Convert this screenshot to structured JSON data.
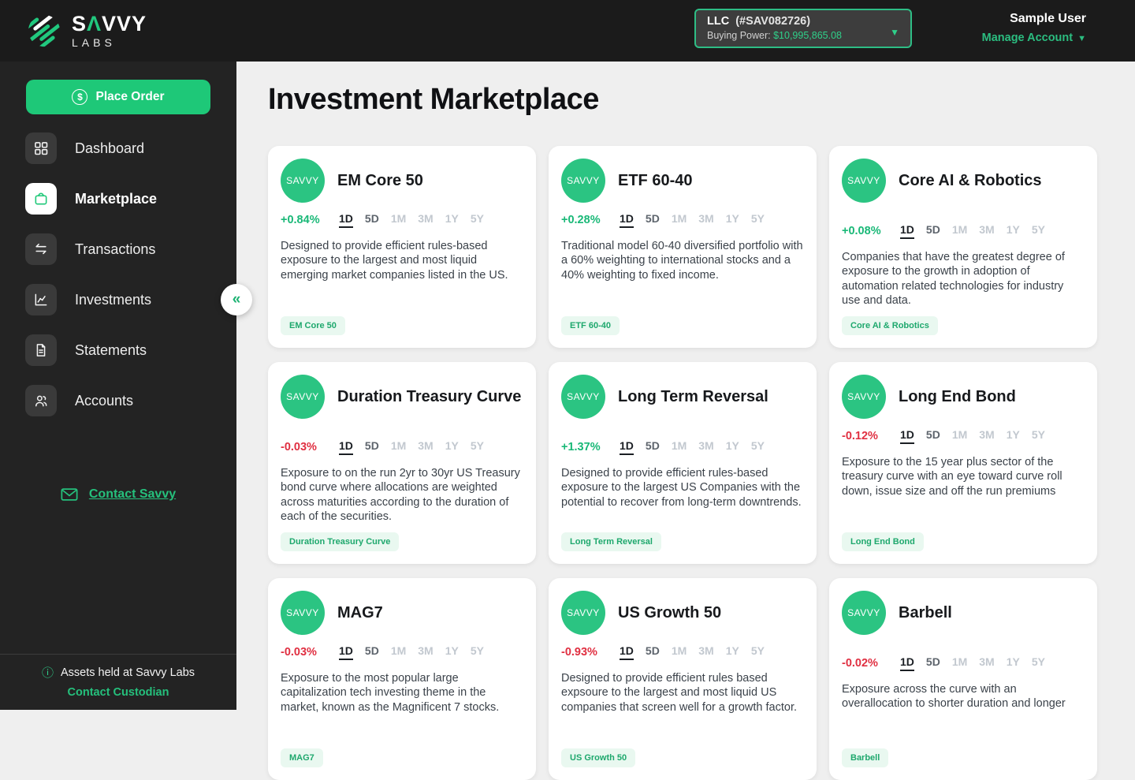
{
  "colors": {
    "accent_green": "#1EC878",
    "positive": "#19B877",
    "negative": "#E02F41",
    "dark_bg": "#1B1B1B",
    "tag_bg": "#E9F8F0",
    "main_bg": "#EFEFEF"
  },
  "brand": {
    "name_prefix": "S",
    "name_a": "Λ",
    "name_suffix": "VVY",
    "sub": "LABS"
  },
  "topbar": {
    "account": {
      "type": "LLC",
      "id": "(#SAV082726)",
      "buying_power_label": "Buying Power:",
      "buying_power_value": "$10,995,865.08"
    },
    "user": {
      "name": "Sample User",
      "manage_label": "Manage Account"
    }
  },
  "sidebar": {
    "place_order_label": "Place Order",
    "items": [
      {
        "label": "Dashboard"
      },
      {
        "label": "Marketplace"
      },
      {
        "label": "Transactions"
      },
      {
        "label": "Investments"
      },
      {
        "label": "Statements"
      },
      {
        "label": "Accounts"
      }
    ],
    "contact_link": "Contact Savvy",
    "footer": {
      "assets_note": "Assets held at Savvy Labs",
      "custodian_link": "Contact Custodian"
    }
  },
  "main": {
    "title": "Investment Marketplace",
    "avatar_label": "SAVVY",
    "timeframes": [
      "1D",
      "5D",
      "1M",
      "3M",
      "1Y",
      "5Y"
    ],
    "active_timeframe": "1D",
    "cards": [
      {
        "title": "EM Core 50",
        "change": "+0.84%",
        "dir": "up",
        "description": "Designed to provide efficient rules-based exposure to the largest and most liquid emerging market companies listed in the US.",
        "tag": "EM Core 50"
      },
      {
        "title": "ETF 60-40",
        "change": "+0.28%",
        "dir": "up",
        "description": "Traditional model 60-40 diversified portfolio with a 60% weighting to international stocks and a 40% weighting to fixed income.",
        "tag": "ETF 60-40"
      },
      {
        "title": "Core AI & Robotics",
        "change": "+0.08%",
        "dir": "up",
        "description": "Companies that have the greatest degree of exposure to the growth in adoption of automation related technologies for industry use and data.",
        "tag": "Core AI & Robotics"
      },
      {
        "title": "Duration Treasury Curve",
        "change": "-0.03%",
        "dir": "down",
        "description": "Exposure to on the run 2yr to 30yr US Treasury bond curve where allocations are weighted across maturities according to the duration of each of the securities.",
        "tag": "Duration Treasury Curve"
      },
      {
        "title": "Long Term Reversal",
        "change": "+1.37%",
        "dir": "up",
        "description": "Designed to provide efficient rules-based exposure to the largest US Companies with the potential to recover from long-term downtrends.",
        "tag": "Long Term Reversal"
      },
      {
        "title": "Long End Bond",
        "change": "-0.12%",
        "dir": "down",
        "description": "Exposure to the 15 year plus sector of the treasury curve with an eye toward curve roll down, issue size and off the run premiums",
        "tag": "Long End Bond"
      },
      {
        "title": "MAG7",
        "change": "-0.03%",
        "dir": "down",
        "description": "Exposure to the most popular large capitalization tech investing theme in the market, known as the Magnificent 7 stocks.",
        "tag": "MAG7"
      },
      {
        "title": "US Growth 50",
        "change": "-0.93%",
        "dir": "down",
        "description": "Designed to provide efficient rules based expsoure to the largest and most liquid US companies that screen well for a growth factor.",
        "tag": "US Growth 50"
      },
      {
        "title": "Barbell",
        "change": "-0.02%",
        "dir": "down",
        "description": "Exposure across the curve with an overallocation to shorter duration and longer",
        "tag": "Barbell"
      }
    ]
  }
}
